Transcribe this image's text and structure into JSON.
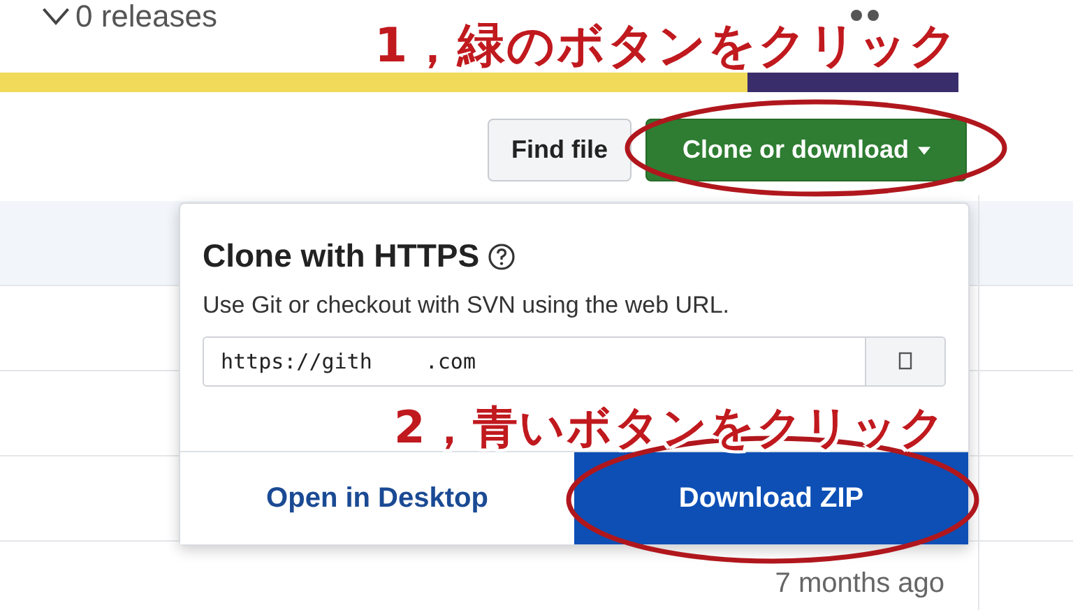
{
  "releases": {
    "text": "0 releases"
  },
  "language_bar": [
    {
      "color": "#f1d95a"
    },
    {
      "color": "#3a2d6b"
    }
  ],
  "buttons": [
    {
      "label": "Find file",
      "kind": "plain"
    },
    {
      "label": "Clone or download",
      "kind": "primary"
    }
  ],
  "popover": {
    "title": "Clone with HTTPS",
    "description": "Use Git or checkout with SVN using the web URL.",
    "url_start": "https://gith",
    "url_end": ".com",
    "actions": [
      {
        "label": "Open in Desktop",
        "selected": false
      },
      {
        "label": "Download ZIP",
        "selected": true
      }
    ]
  },
  "timestamp": "7 months ago",
  "annotations": [
    {
      "text": "1，緑のボタンをクリック"
    },
    {
      "text": "2，青いボタンをクリック"
    }
  ]
}
